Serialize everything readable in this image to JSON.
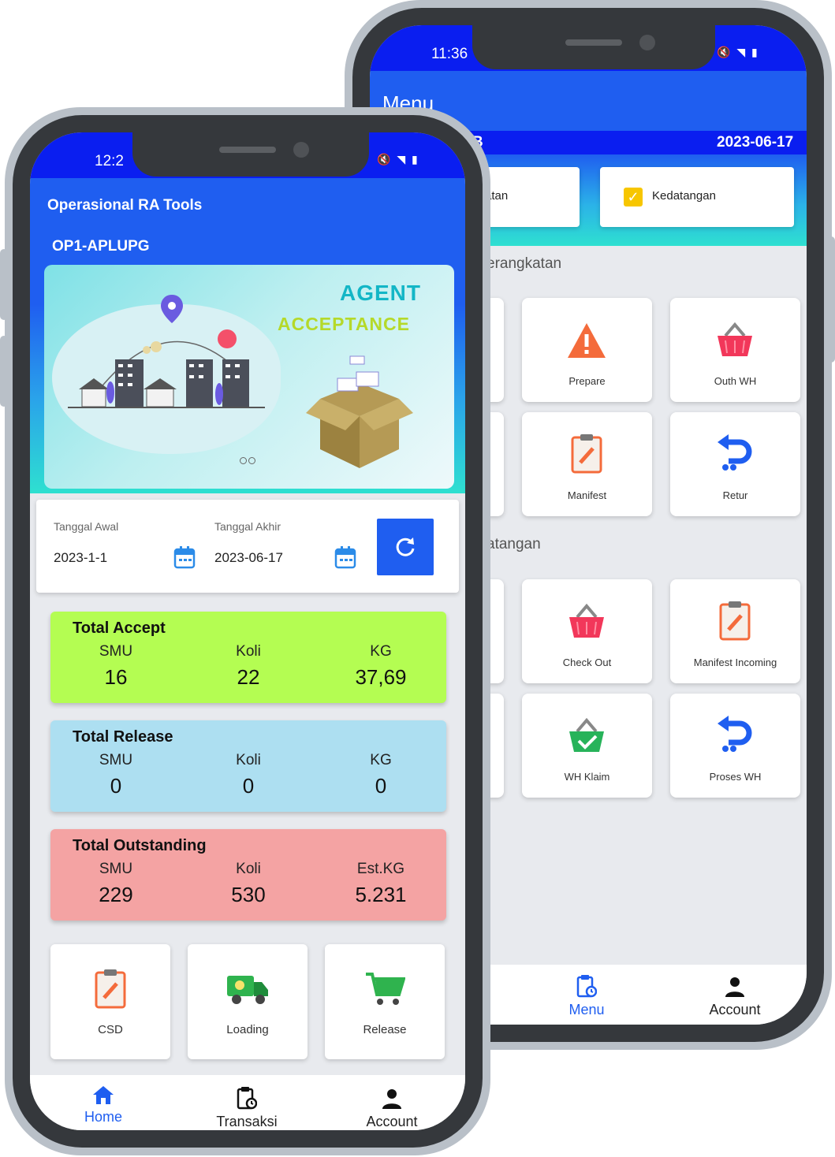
{
  "back_phone": {
    "status_time": "11:36",
    "header_title": "Menu",
    "sub_left": "B",
    "sub_date": "2023-06-17",
    "tab_left_label": "atan",
    "tab_right_label": "Kedatangan",
    "section1": "erangkatan",
    "section2": "atangan",
    "tiles": [
      {
        "label": "Prepare",
        "icon": "warning-icon"
      },
      {
        "label": "Outh WH",
        "icon": "basket-icon"
      },
      {
        "label": "Manifest",
        "icon": "clipboard-icon"
      },
      {
        "label": "Retur",
        "icon": "return-icon"
      },
      {
        "label": "Check Out",
        "icon": "basket-icon"
      },
      {
        "label": "Manifest Incoming",
        "icon": "clipboard-icon"
      },
      {
        "label": "WH Klaim",
        "icon": "basket-check-icon"
      },
      {
        "label": "Proses WH",
        "icon": "return-icon"
      }
    ],
    "nav": {
      "menu": "Menu",
      "account": "Account"
    }
  },
  "front_phone": {
    "status_time": "12:2",
    "app_title": "Operasional RA Tools",
    "user_code": "OP1-APLUPG",
    "banner": {
      "line1": "AGENT",
      "line2": "ACCEPTANCE"
    },
    "filter": {
      "start_label": "Tanggal Awal",
      "start_value": "2023-1-1",
      "end_label": "Tanggal Akhir",
      "end_value": "2023-06-17"
    },
    "stats": [
      {
        "title": "Total Accept",
        "c1": "SMU",
        "v1": "16",
        "c2": "Koli",
        "v2": "22",
        "c3": "KG",
        "v3": "37,69",
        "color": "#b4fd52"
      },
      {
        "title": "Total Release",
        "c1": "SMU",
        "v1": "0",
        "c2": "Koli",
        "v2": "0",
        "c3": "KG",
        "v3": "0",
        "color": "#addff1"
      },
      {
        "title": "Total Outstanding",
        "c1": "SMU",
        "v1": "229",
        "c2": "Koli",
        "v2": "530",
        "c3": "Est.KG",
        "v3": "5.231",
        "color": "#f4a3a3"
      }
    ],
    "actions": [
      {
        "label": "CSD",
        "icon": "clipboard-icon"
      },
      {
        "label": "Loading",
        "icon": "truck-icon"
      },
      {
        "label": "Release",
        "icon": "cart-icon"
      }
    ],
    "nav": {
      "home": "Home",
      "transaksi": "Transaksi",
      "account": "Account"
    }
  },
  "colors": {
    "primary": "#1f5ef0",
    "status_blue": "#0a1ef0",
    "accent_cyan": "#2ee0d0"
  }
}
